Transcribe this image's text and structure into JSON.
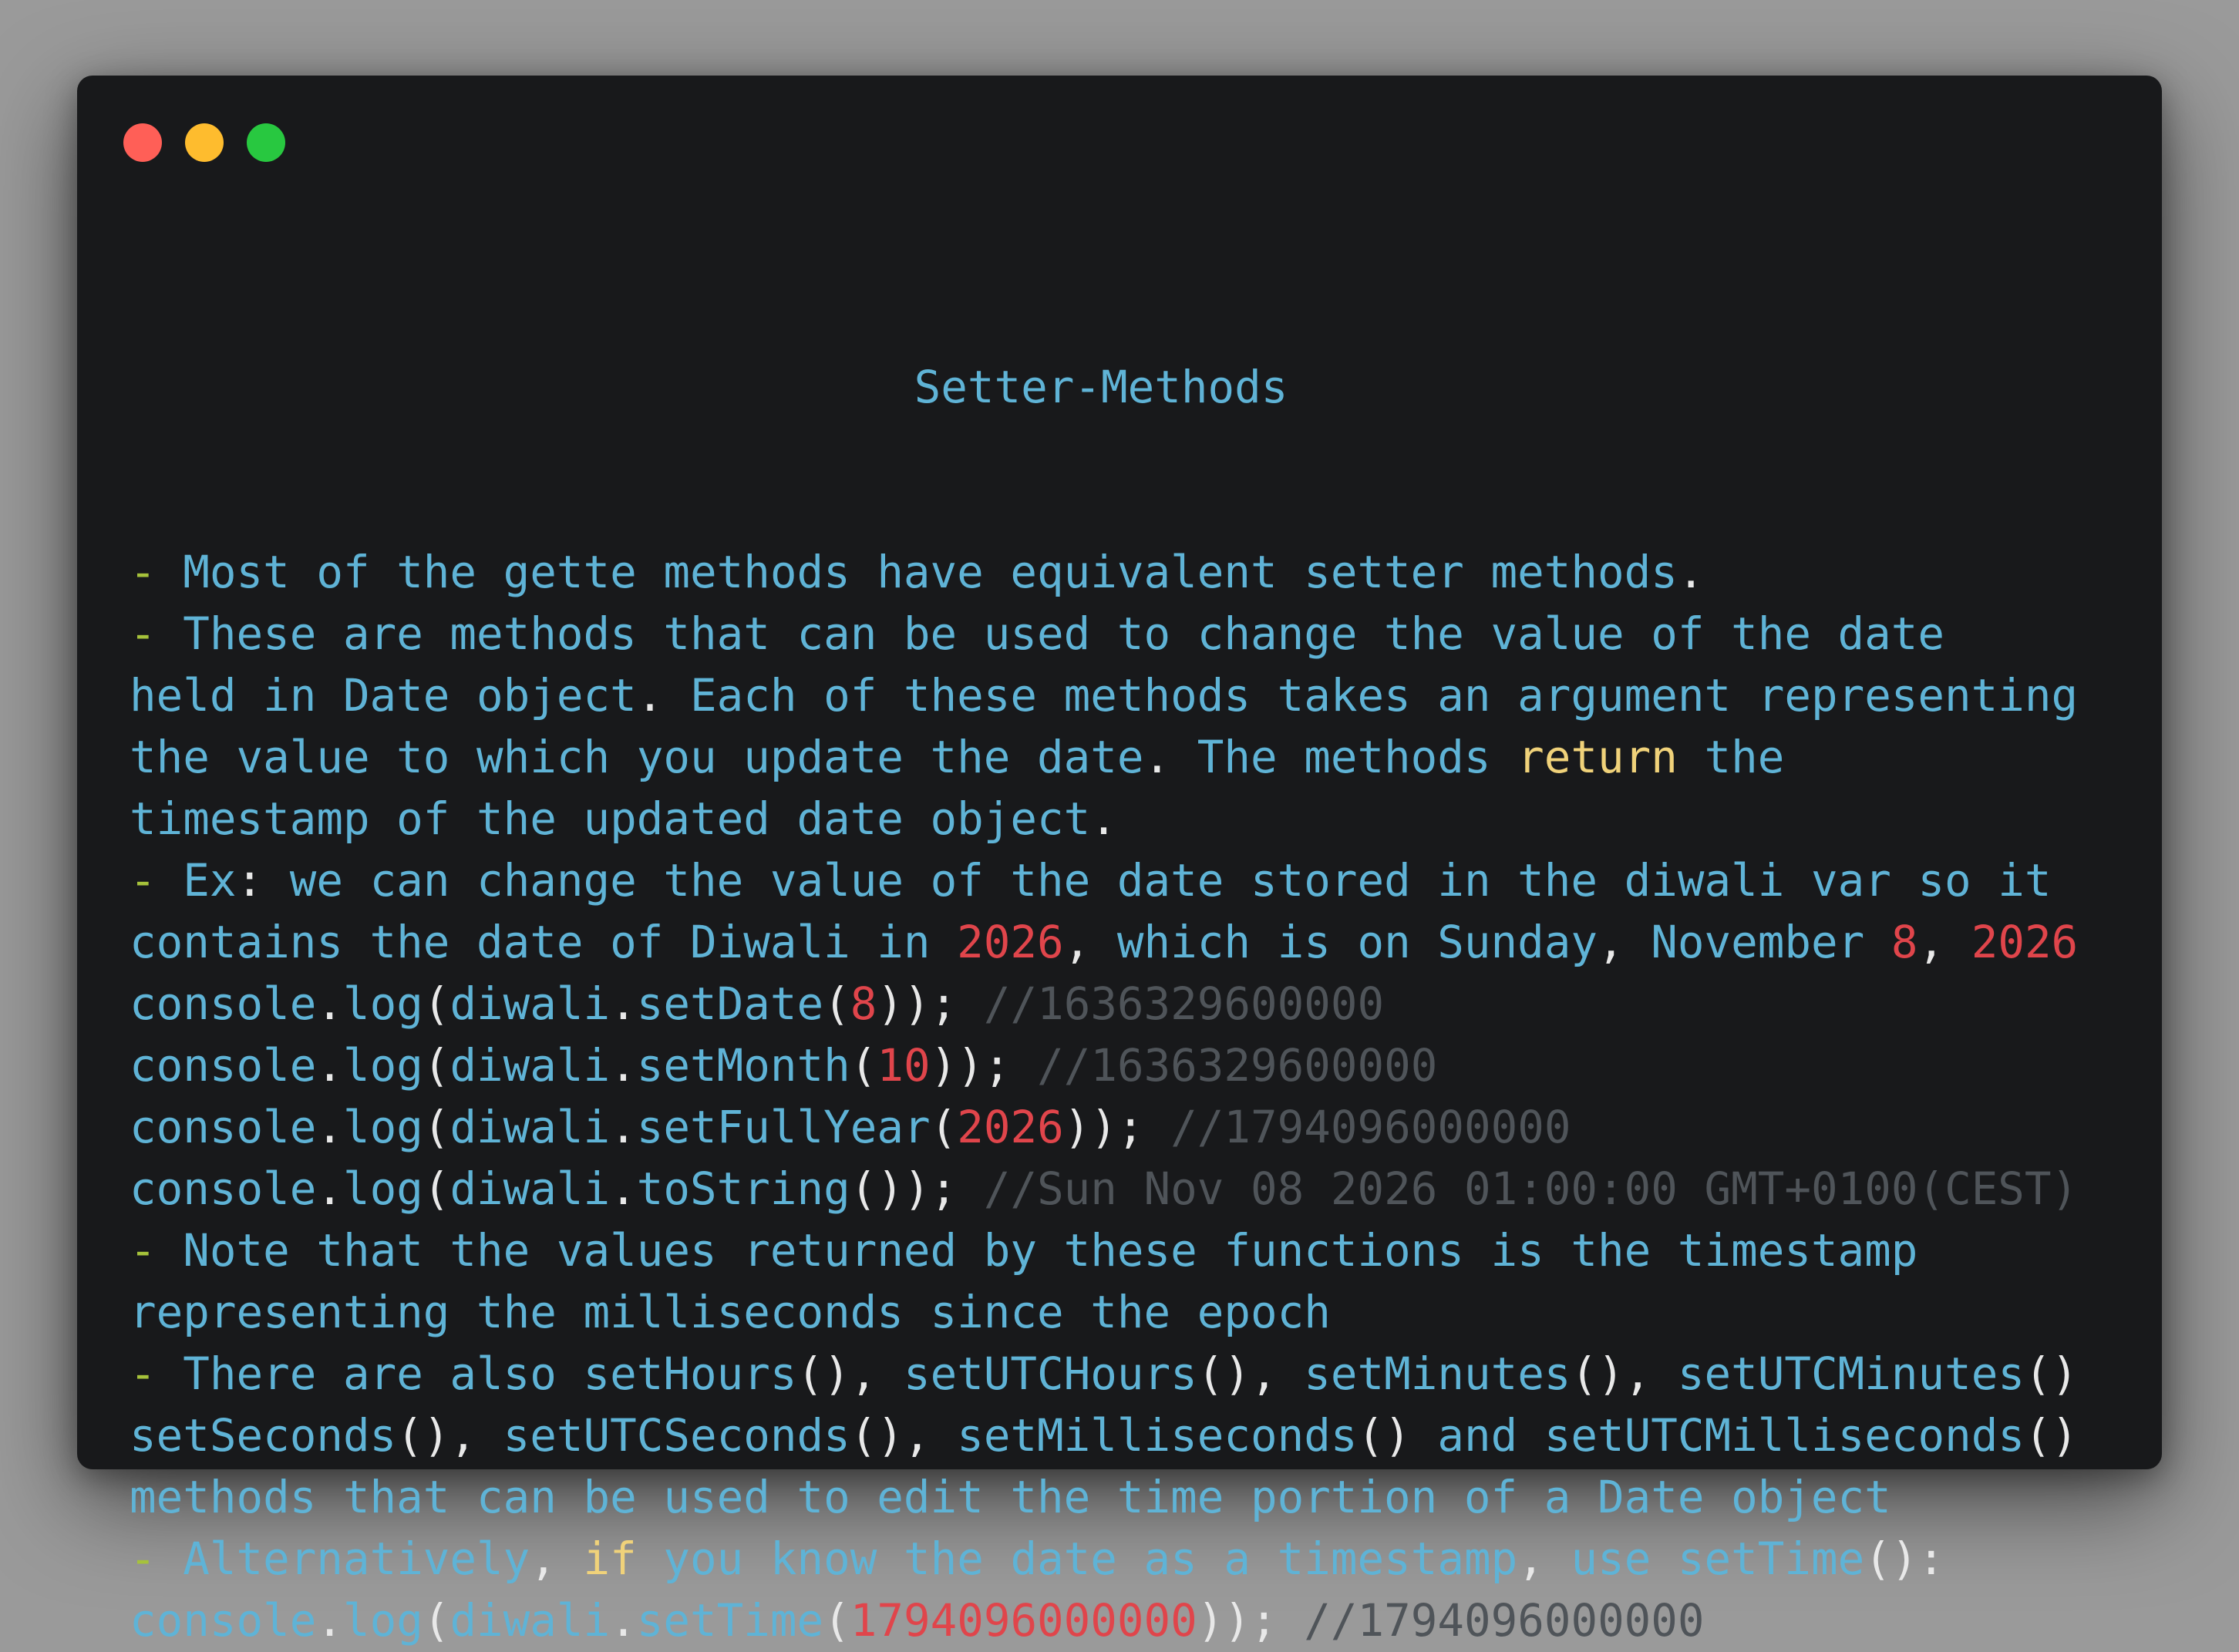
{
  "window": {
    "traffic_lights": [
      "close",
      "minimize",
      "maximize"
    ]
  },
  "code": {
    "title": "Setter-Methods",
    "lines": [
      [
        {
          "t": "d",
          "v": "- "
        },
        {
          "t": "t",
          "v": "Most of the gette methods have equivalent setter methods"
        },
        {
          "t": "p",
          "v": "."
        }
      ],
      [
        {
          "t": "d",
          "v": "- "
        },
        {
          "t": "t",
          "v": "These are methods that can be used to change the value of the date"
        }
      ],
      [
        {
          "t": "t",
          "v": "held in Date object"
        },
        {
          "t": "p",
          "v": ". "
        },
        {
          "t": "t",
          "v": "Each of these methods takes an argument representing"
        }
      ],
      [
        {
          "t": "t",
          "v": "the value to which you update the date"
        },
        {
          "t": "p",
          "v": ". "
        },
        {
          "t": "t",
          "v": "The methods "
        },
        {
          "t": "k",
          "v": "return"
        },
        {
          "t": "t",
          "v": " the"
        }
      ],
      [
        {
          "t": "t",
          "v": "timestamp of the updated date object"
        },
        {
          "t": "p",
          "v": "."
        }
      ],
      [
        {
          "t": "d",
          "v": "- "
        },
        {
          "t": "t",
          "v": "Ex"
        },
        {
          "t": "p",
          "v": ": "
        },
        {
          "t": "t",
          "v": "we can change the value of the date stored in the diwali var so it"
        }
      ],
      [
        {
          "t": "t",
          "v": "contains the date of Diwali in "
        },
        {
          "t": "n",
          "v": "2026"
        },
        {
          "t": "p",
          "v": ", "
        },
        {
          "t": "t",
          "v": "which is on Sunday"
        },
        {
          "t": "p",
          "v": ", "
        },
        {
          "t": "t",
          "v": "November "
        },
        {
          "t": "n",
          "v": "8"
        },
        {
          "t": "p",
          "v": ", "
        },
        {
          "t": "n",
          "v": "2026"
        }
      ],
      [
        {
          "t": "t",
          "v": "console"
        },
        {
          "t": "p",
          "v": "."
        },
        {
          "t": "t",
          "v": "log"
        },
        {
          "t": "p",
          "v": "("
        },
        {
          "t": "t",
          "v": "diwali"
        },
        {
          "t": "p",
          "v": "."
        },
        {
          "t": "t",
          "v": "setDate"
        },
        {
          "t": "p",
          "v": "("
        },
        {
          "t": "n",
          "v": "8"
        },
        {
          "t": "p",
          "v": ")); "
        },
        {
          "t": "c",
          "v": "//1636329600000"
        }
      ],
      [
        {
          "t": "t",
          "v": "console"
        },
        {
          "t": "p",
          "v": "."
        },
        {
          "t": "t",
          "v": "log"
        },
        {
          "t": "p",
          "v": "("
        },
        {
          "t": "t",
          "v": "diwali"
        },
        {
          "t": "p",
          "v": "."
        },
        {
          "t": "t",
          "v": "setMonth"
        },
        {
          "t": "p",
          "v": "("
        },
        {
          "t": "n",
          "v": "10"
        },
        {
          "t": "p",
          "v": ")); "
        },
        {
          "t": "c",
          "v": "//1636329600000"
        }
      ],
      [
        {
          "t": "t",
          "v": "console"
        },
        {
          "t": "p",
          "v": "."
        },
        {
          "t": "t",
          "v": "log"
        },
        {
          "t": "p",
          "v": "("
        },
        {
          "t": "t",
          "v": "diwali"
        },
        {
          "t": "p",
          "v": "."
        },
        {
          "t": "t",
          "v": "setFullYear"
        },
        {
          "t": "p",
          "v": "("
        },
        {
          "t": "n",
          "v": "2026"
        },
        {
          "t": "p",
          "v": ")); "
        },
        {
          "t": "c",
          "v": "//1794096000000"
        }
      ],
      [
        {
          "t": "t",
          "v": "console"
        },
        {
          "t": "p",
          "v": "."
        },
        {
          "t": "t",
          "v": "log"
        },
        {
          "t": "p",
          "v": "("
        },
        {
          "t": "t",
          "v": "diwali"
        },
        {
          "t": "p",
          "v": "."
        },
        {
          "t": "t",
          "v": "toString"
        },
        {
          "t": "p",
          "v": "()); "
        },
        {
          "t": "c",
          "v": "//Sun Nov 08 2026 01:00:00 GMT+0100(CEST)"
        }
      ],
      [
        {
          "t": "d",
          "v": "- "
        },
        {
          "t": "t",
          "v": "Note that the values returned by these functions is the timestamp"
        }
      ],
      [
        {
          "t": "t",
          "v": "representing the milliseconds since the epoch"
        }
      ],
      [
        {
          "t": "d",
          "v": "- "
        },
        {
          "t": "t",
          "v": "There are also setHours"
        },
        {
          "t": "p",
          "v": "(), "
        },
        {
          "t": "t",
          "v": "setUTCHours"
        },
        {
          "t": "p",
          "v": "(), "
        },
        {
          "t": "t",
          "v": "setMinutes"
        },
        {
          "t": "p",
          "v": "(), "
        },
        {
          "t": "t",
          "v": "setUTCMinutes"
        },
        {
          "t": "p",
          "v": "()"
        }
      ],
      [
        {
          "t": "t",
          "v": "setSeconds"
        },
        {
          "t": "p",
          "v": "(), "
        },
        {
          "t": "t",
          "v": "setUTCSeconds"
        },
        {
          "t": "p",
          "v": "(), "
        },
        {
          "t": "t",
          "v": "setMilliseconds"
        },
        {
          "t": "p",
          "v": "() "
        },
        {
          "t": "t",
          "v": "and setUTCMilliseconds"
        },
        {
          "t": "p",
          "v": "()"
        }
      ],
      [
        {
          "t": "t",
          "v": "methods that can be used to edit the time portion of a Date object"
        }
      ],
      [
        {
          "t": "d",
          "v": "- "
        },
        {
          "t": "t",
          "v": "Alternatively"
        },
        {
          "t": "p",
          "v": ", "
        },
        {
          "t": "k",
          "v": "if"
        },
        {
          "t": "t",
          "v": " you know the date as a timestamp"
        },
        {
          "t": "p",
          "v": ", "
        },
        {
          "t": "t",
          "v": "use setTime"
        },
        {
          "t": "p",
          "v": "():"
        }
      ],
      [
        {
          "t": "t",
          "v": "console"
        },
        {
          "t": "p",
          "v": "."
        },
        {
          "t": "t",
          "v": "log"
        },
        {
          "t": "p",
          "v": "("
        },
        {
          "t": "t",
          "v": "diwali"
        },
        {
          "t": "p",
          "v": "."
        },
        {
          "t": "t",
          "v": "setTime"
        },
        {
          "t": "p",
          "v": "("
        },
        {
          "t": "n",
          "v": "1794096000000"
        },
        {
          "t": "p",
          "v": ")); "
        },
        {
          "t": "c",
          "v": "//1794096000000"
        }
      ]
    ]
  },
  "colors": {
    "background": "#9a9a9a",
    "window": "#18191b",
    "text": "#5fb3d6",
    "keyword": "#f0d27a",
    "number": "#e0454b",
    "comment": "#4f5459",
    "punctuation": "#e8e8e8",
    "dash": "#a6c23b"
  }
}
